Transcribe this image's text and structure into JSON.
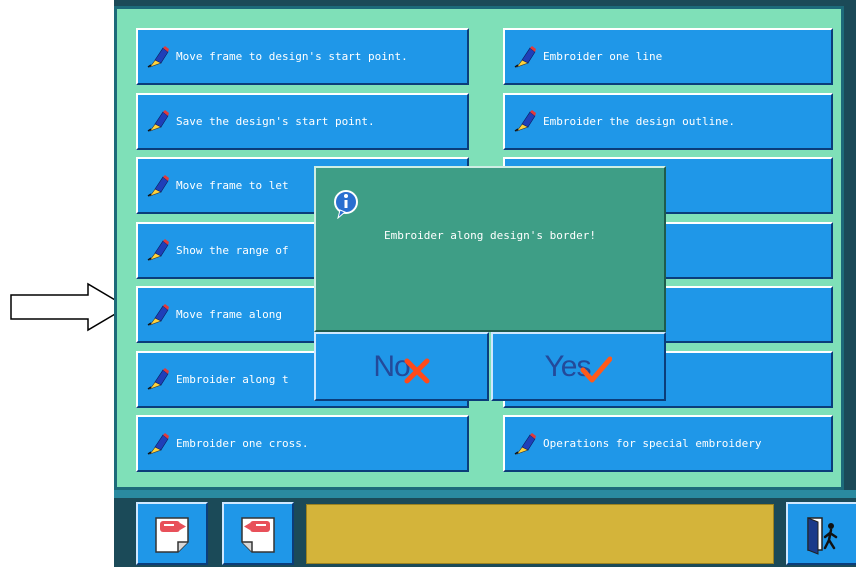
{
  "menu": {
    "left": [
      {
        "label": "Move frame to design's start point."
      },
      {
        "label": "Save the design's start point."
      },
      {
        "label": "Move frame to let"
      },
      {
        "label": "Show the range of"
      },
      {
        "label": "Move frame along"
      },
      {
        "label": "Embroider along t"
      },
      {
        "label": "Embroider one cross."
      }
    ],
    "right": [
      {
        "label": "Embroider one line"
      },
      {
        "label": "Embroider the design outline."
      },
      {
        "label": "s offset point."
      },
      {
        "label": "n to loosen cloth"
      },
      {
        "label": ""
      },
      {
        "label": "titches"
      },
      {
        "label": "Operations for special embroidery"
      }
    ]
  },
  "dialog": {
    "message": "Embroider along design's border!",
    "no_label": "No",
    "yes_label": "Yes"
  },
  "status_bar": {
    "text": ""
  },
  "colors": {
    "button_blue": "#1f97e8",
    "panel_green": "#7fe0b8",
    "dialog_green": "#3e9e86",
    "status_yellow": "#d4b43a"
  },
  "icons": {
    "menu_item": "pen-hand-icon",
    "dialog": "info-icon",
    "no": "x-mark-icon",
    "yes": "check-mark-icon",
    "toolbar": [
      "page-back-icon",
      "page-forward-icon",
      "exit-door-icon"
    ]
  }
}
